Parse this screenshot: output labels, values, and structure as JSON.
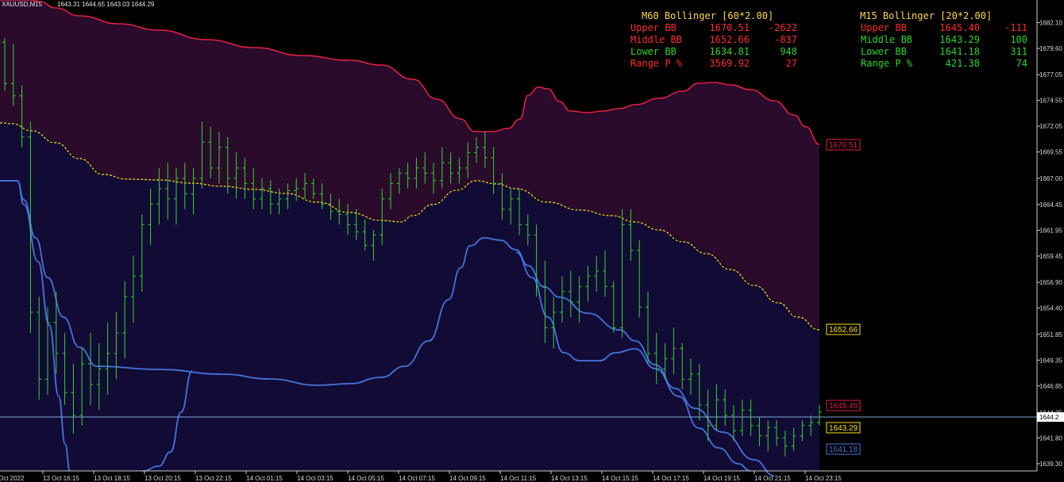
{
  "header": {
    "symbol": "XAUUSD,M15",
    "ohlc": "1643.31 1644.65 1643.03 1644.29"
  },
  "colors": {
    "background": "#000000",
    "candles": "#34d62b",
    "m60_band": "#e01f47",
    "m60_mid": "#ffe11f",
    "m15_band": "#4473dd",
    "price_line": "#7ea6d8",
    "upper_fill": "#2a0b2c",
    "lower_fill": "#120b36",
    "label_red": "#ff2b2b",
    "label_green": "#2cd52c",
    "label_yellow": "#ffd54a"
  },
  "panels": {
    "m60": {
      "title": "M60 Bollinger [60*2.00]",
      "rows": [
        {
          "label": "Upper BB",
          "value": "1670.51",
          "diff": "-2622",
          "color": "red"
        },
        {
          "label": "Middle BB",
          "value": "1652.66",
          "diff": "-837",
          "color": "red"
        },
        {
          "label": "Lower BB",
          "value": "1634.81",
          "diff": "948",
          "color": "green"
        },
        {
          "label": "Range P %",
          "value": "3569.92",
          "diff": "27",
          "color": "red"
        }
      ]
    },
    "m15": {
      "title": "M15 Bollinger [20*2.00]",
      "rows": [
        {
          "label": "Upper BB",
          "value": "1645.40",
          "diff": "-111",
          "color": "red"
        },
        {
          "label": "Middle BB",
          "value": "1643.29",
          "diff": "100",
          "color": "green"
        },
        {
          "label": "Lower BB",
          "value": "1641.18",
          "diff": "311",
          "color": "green"
        },
        {
          "label": "Range P %",
          "value": "421.38",
          "diff": "74",
          "color": "green"
        }
      ]
    }
  },
  "chart_data": {
    "type": "candlestick",
    "instrument": "XAUUSD",
    "timeframe": "M15",
    "ylim": [
      1638.6,
      1684.3
    ],
    "y_ticks": [
      "1682.10",
      "1679.60",
      "1677.05",
      "1674.55",
      "1672.05",
      "1669.55",
      "1667.00",
      "1664.45",
      "1661.95",
      "1659.45",
      "1656.90",
      "1654.40",
      "1651.85",
      "1649.35",
      "1646.85",
      "1644.25",
      "1641.80",
      "1639.30"
    ],
    "x_ticks": [
      "Oct 2022",
      "13 Oct 16:15",
      "13 Oct 18:15",
      "13 Oct 20:15",
      "13 Oct 22:15",
      "14 Oct 01:15",
      "14 Oct 03:15",
      "14 Oct 05:15",
      "14 Oct 07:15",
      "14 Oct 09:15",
      "14 Oct 11:15",
      "14 Oct 13:15",
      "14 Oct 15:15",
      "14 Oct 17:15",
      "14 Oct 19:15",
      "14 Oct 21:15",
      "14 Oct 23:15"
    ],
    "current_price": "1644.2",
    "series": [
      {
        "name": "Upper BB",
        "frame": "M60",
        "value": 1670.51,
        "label": "1670.51"
      },
      {
        "name": "Middle BB",
        "frame": "M60",
        "value": 1652.66,
        "label": "1652.66"
      },
      {
        "name": "Upper BB",
        "frame": "M15",
        "value": 1645.4,
        "label": "1645.40"
      },
      {
        "name": "Middle BB",
        "frame": "M15",
        "value": 1643.29,
        "label": "1643.29"
      },
      {
        "name": "Lower BB",
        "frame": "M15",
        "value": 1641.18,
        "label": "1641.18"
      }
    ],
    "candles": [
      [
        1680.2,
        1680.6,
        1675.5,
        1676.2
      ],
      [
        1676.2,
        1680.0,
        1674.0,
        1675.0
      ],
      [
        1675.0,
        1676.0,
        1670.0,
        1671.0
      ],
      [
        1671.0,
        1672.5,
        1652.0,
        1654.0
      ],
      [
        1654.0,
        1655.5,
        1645.5,
        1647.5
      ],
      [
        1647.5,
        1654.5,
        1646.0,
        1653.0
      ],
      [
        1653.0,
        1656.0,
        1648.0,
        1650.0
      ],
      [
        1650.0,
        1652.0,
        1645.0,
        1646.2
      ],
      [
        1646.2,
        1649.0,
        1642.2,
        1644.0
      ],
      [
        1644.0,
        1650.5,
        1643.0,
        1649.0
      ],
      [
        1649.0,
        1652.0,
        1645.0,
        1647.0
      ],
      [
        1647.0,
        1651.0,
        1644.5,
        1648.5
      ],
      [
        1648.5,
        1653.0,
        1646.0,
        1650.0
      ],
      [
        1650.0,
        1654.0,
        1647.5,
        1652.0
      ],
      [
        1652.0,
        1657.0,
        1649.5,
        1655.5
      ],
      [
        1655.5,
        1659.5,
        1653.0,
        1657.5
      ],
      [
        1657.5,
        1663.5,
        1656.0,
        1662.5
      ],
      [
        1662.5,
        1666.0,
        1660.5,
        1664.5
      ],
      [
        1664.5,
        1668.0,
        1662.5,
        1666.0
      ],
      [
        1666.0,
        1668.5,
        1663.0,
        1665.0
      ],
      [
        1665.0,
        1668.0,
        1662.5,
        1667.0
      ],
      [
        1667.0,
        1668.5,
        1664.0,
        1665.5
      ],
      [
        1665.5,
        1668.0,
        1663.5,
        1667.0
      ],
      [
        1667.0,
        1672.5,
        1666.0,
        1670.5
      ],
      [
        1670.5,
        1672.0,
        1667.0,
        1668.0
      ],
      [
        1668.0,
        1671.5,
        1666.5,
        1670.0
      ],
      [
        1670.0,
        1671.0,
        1665.5,
        1667.0
      ],
      [
        1667.0,
        1669.5,
        1665.0,
        1668.0
      ],
      [
        1668.0,
        1669.0,
        1665.0,
        1666.5
      ],
      [
        1666.5,
        1668.0,
        1664.0,
        1665.0
      ],
      [
        1665.0,
        1667.0,
        1664.0,
        1666.0
      ],
      [
        1666.0,
        1666.8,
        1663.5,
        1664.5
      ],
      [
        1664.5,
        1666.0,
        1663.5,
        1665.0
      ],
      [
        1665.0,
        1666.5,
        1664.0,
        1665.8
      ],
      [
        1665.8,
        1667.0,
        1664.8,
        1666.0
      ],
      [
        1666.0,
        1667.5,
        1665.0,
        1666.5
      ],
      [
        1666.5,
        1667.0,
        1665.0,
        1665.5
      ],
      [
        1665.5,
        1666.5,
        1664.0,
        1664.5
      ],
      [
        1664.5,
        1665.5,
        1663.0,
        1663.8
      ],
      [
        1663.8,
        1665.0,
        1662.5,
        1663.5
      ],
      [
        1663.5,
        1664.5,
        1661.5,
        1662.5
      ],
      [
        1662.5,
        1664.0,
        1661.0,
        1661.8
      ],
      [
        1661.8,
        1663.0,
        1660.0,
        1660.5
      ],
      [
        1660.5,
        1662.0,
        1659.0,
        1661.5
      ],
      [
        1661.5,
        1666.0,
        1660.5,
        1665.0
      ],
      [
        1665.0,
        1667.5,
        1664.0,
        1666.5
      ],
      [
        1666.5,
        1668.0,
        1665.5,
        1667.5
      ],
      [
        1667.5,
        1668.5,
        1666.0,
        1667.0
      ],
      [
        1667.0,
        1669.0,
        1666.0,
        1668.0
      ],
      [
        1668.0,
        1669.5,
        1666.5,
        1667.5
      ],
      [
        1667.5,
        1668.5,
        1665.5,
        1666.8
      ],
      [
        1666.8,
        1670.0,
        1666.0,
        1668.5
      ],
      [
        1668.5,
        1669.5,
        1666.5,
        1667.5
      ],
      [
        1667.5,
        1669.0,
        1666.5,
        1668.0
      ],
      [
        1668.0,
        1670.5,
        1667.0,
        1669.5
      ],
      [
        1669.5,
        1671.0,
        1668.5,
        1670.0
      ],
      [
        1670.0,
        1671.5,
        1668.0,
        1669.0
      ],
      [
        1669.0,
        1670.0,
        1665.5,
        1666.5
      ],
      [
        1666.5,
        1667.5,
        1663.0,
        1664.0
      ],
      [
        1664.0,
        1666.0,
        1662.5,
        1665.0
      ],
      [
        1665.0,
        1666.0,
        1661.5,
        1662.5
      ],
      [
        1662.5,
        1663.5,
        1660.5,
        1661.5
      ],
      [
        1661.5,
        1662.5,
        1655.5,
        1656.5
      ],
      [
        1656.5,
        1659.0,
        1651.0,
        1652.5
      ],
      [
        1652.5,
        1655.5,
        1650.5,
        1654.0
      ],
      [
        1654.0,
        1657.5,
        1653.0,
        1656.0
      ],
      [
        1656.0,
        1658.0,
        1653.5,
        1655.0
      ],
      [
        1655.0,
        1657.5,
        1653.0,
        1656.5
      ],
      [
        1656.5,
        1658.5,
        1655.0,
        1657.5
      ],
      [
        1657.5,
        1659.5,
        1656.0,
        1658.0
      ],
      [
        1658.0,
        1660.0,
        1655.5,
        1656.5
      ],
      [
        1656.5,
        1657.0,
        1652.0,
        1652.5
      ],
      [
        1652.5,
        1664.0,
        1651.5,
        1662.5
      ],
      [
        1662.5,
        1664.0,
        1659.0,
        1660.0
      ],
      [
        1660.0,
        1661.0,
        1653.5,
        1654.5
      ],
      [
        1654.5,
        1656.0,
        1649.0,
        1650.0
      ],
      [
        1650.0,
        1652.0,
        1647.0,
        1648.5
      ],
      [
        1648.5,
        1651.0,
        1647.5,
        1649.5
      ],
      [
        1649.5,
        1652.5,
        1648.0,
        1650.5
      ],
      [
        1650.5,
        1651.0,
        1646.5,
        1647.5
      ],
      [
        1647.5,
        1649.5,
        1646.0,
        1648.0
      ],
      [
        1648.0,
        1649.0,
        1643.5,
        1645.0
      ],
      [
        1645.0,
        1646.5,
        1641.5,
        1643.0
      ],
      [
        1643.0,
        1647.0,
        1642.5,
        1645.5
      ],
      [
        1645.5,
        1646.5,
        1643.0,
        1644.0
      ],
      [
        1644.0,
        1645.0,
        1641.5,
        1642.5
      ],
      [
        1642.5,
        1645.5,
        1642.0,
        1644.5
      ],
      [
        1644.5,
        1645.5,
        1642.0,
        1643.0
      ],
      [
        1643.0,
        1643.8,
        1641.0,
        1642.0
      ],
      [
        1642.0,
        1643.5,
        1640.5,
        1642.8
      ],
      [
        1642.8,
        1643.5,
        1641.0,
        1641.8
      ],
      [
        1641.8,
        1642.5,
        1640.0,
        1641.0
      ],
      [
        1641.0,
        1642.8,
        1640.5,
        1642.0
      ],
      [
        1642.0,
        1643.5,
        1641.5,
        1643.0
      ],
      [
        1643.0,
        1644.0,
        1642.0,
        1643.3
      ],
      [
        1643.3,
        1645.0,
        1643.0,
        1644.3
      ]
    ]
  }
}
